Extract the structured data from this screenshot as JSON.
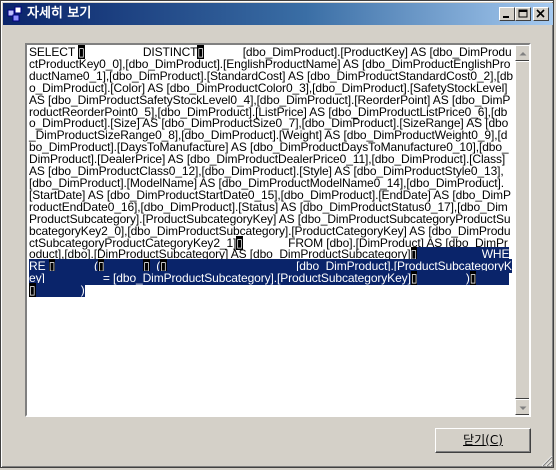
{
  "window": {
    "title": "자세히 보기",
    "icons": {
      "app": "app-icon",
      "minimize": "minimize-icon",
      "maximize": "maximize-icon",
      "close": "close-icon"
    }
  },
  "query": {
    "segments": [
      {
        "t": "SELECT "
      },
      {
        "t": "▯",
        "s": "blk"
      },
      {
        "t": "                  DISTINCT"
      },
      {
        "t": "▯",
        "s": "blk"
      },
      {
        "t": "            [dbo_DimProduct].[ProductKey] AS [dbo_DimProductProductKey0_0],[dbo_DimProduct].[EnglishProductName] AS [dbo_DimProductEnglishProductName0_1],[dbo_DimProduct].[StandardCost] AS [dbo_DimProductStandardCost0_2],[dbo_DimProduct].[Color] AS [dbo_DimProductColor0_3],[dbo_DimProduct].[SafetyStockLevel] AS [dbo_DimProductSafetyStockLevel0_4],[dbo_DimProduct].[ReorderPoint] AS [dbo_DimProductReorderPoint0_5],[dbo_DimProduct].[ListPrice] AS [dbo_DimProductListPrice0_6],[dbo_DimProduct].[Size] AS [dbo_DimProductSize0_7],[dbo_DimProduct].[SizeRange] AS [dbo_DimProductSizeRange0_8],[dbo_DimProduct].[Weight] AS [dbo_DimProductWeight0_9],[dbo_DimProduct].[DaysToManufacture] AS [dbo_DimProductDaysToManufacture0_10],[dbo_DimProduct].[DealerPrice] AS [dbo_DimProductDealerPrice0_11],[dbo_DimProduct].[Class] AS [dbo_DimProductClass0_12],[dbo_DimProduct].[Style] AS [dbo_DimProductStyle0_13],[dbo_DimProduct].[ModelName] AS [dbo_DimProductModelName0_14],[dbo_DimProduct].[StartDate] AS [dbo_DimProductStartDate0_15],[dbo_DimProduct].[EndDate] AS [dbo_DimProductEndDate0_16],[dbo_DimProduct].[Status] AS [dbo_DimProductStatus0_17],[dbo_DimProductSubcategory].[ProductSubcategoryKey] AS [dbo_DimProductSubcategoryProductSubcategoryKey2_0],[dbo_DimProductSubcategory].[ProductCategoryKey] AS [dbo_DimProductSubcategoryProductCategoryKey2_1]"
      },
      {
        "t": "▯",
        "s": "blk"
      },
      {
        "t": "              FROM [dbo].[DimProduct] AS [dbo_DimProduct],[dbo].[DimProductSubcategory] AS [dbo_DimProductSubcategory]"
      },
      {
        "t": "▯",
        "s": "blk"
      },
      {
        "t": "                    WHERE ",
        "s": "sel"
      },
      {
        "t": "▯",
        "s": "blk"
      },
      {
        "t": "            (",
        "s": "sel"
      },
      {
        "t": "▯",
        "s": "blk"
      },
      {
        "t": "            ",
        "s": "sel"
      },
      {
        "t": "▯",
        "s": "blk"
      },
      {
        "t": "  ",
        "s": "sel"
      },
      {
        "t": "(",
        "s": "sel"
      },
      {
        "t": "▯",
        "s": "blk"
      },
      {
        "t": "                                        ",
        "s": "sel"
      },
      {
        "t": "[dbo_DimProduct].[ProductSubcategoryKey]                  = [dbo_DimProductSubcategory].[ProductSubcategoryKey]",
        "s": "sel"
      },
      {
        "t": "▯",
        "s": "blk"
      },
      {
        "t": "               )",
        "s": "sel"
      },
      {
        "t": "▯",
        "s": "blk"
      },
      {
        "t": "          ",
        "s": "sel"
      },
      {
        "t": "▯",
        "s": "blk"
      },
      {
        "t": "              )",
        "s": "sel"
      }
    ]
  },
  "scrollbar": {
    "up_icon": "arrow-up-icon",
    "down_icon": "arrow-down-icon"
  },
  "buttons": {
    "close_label": "닫기",
    "close_mnemonic": "C"
  }
}
